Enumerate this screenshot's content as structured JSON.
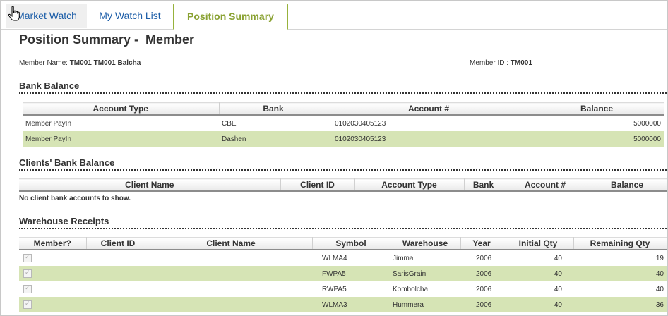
{
  "tabs": {
    "market_watch": "Market Watch",
    "my_watch_list": "My Watch List",
    "position_summary": "Position Summary"
  },
  "page": {
    "title": "Position Summary -  Member",
    "member_name_label": "Member Name:",
    "member_name_value": "TM001 TM001 Balcha",
    "member_id_label": "Member ID :",
    "member_id_value": "TM001"
  },
  "bank_balance": {
    "title": "Bank Balance",
    "headers": [
      "Account Type",
      "Bank",
      "Account #",
      "Balance"
    ],
    "rows": [
      {
        "account_type": "Member PayIn",
        "bank": "CBE",
        "account": "0102030405123",
        "balance": "5000000"
      },
      {
        "account_type": "Member PayIn",
        "bank": "Dashen",
        "account": "0102030405123",
        "balance": "5000000"
      }
    ]
  },
  "clients_bank_balance": {
    "title": "Clients' Bank Balance",
    "headers": [
      "Client Name",
      "Client ID",
      "Account Type",
      "Bank",
      "Account #",
      "Balance"
    ],
    "empty_message": "No client bank accounts to show."
  },
  "warehouse_receipts": {
    "title": "Warehouse Receipts",
    "headers": [
      "Member?",
      "Client ID",
      "Client Name",
      "Symbol",
      "Warehouse",
      "Year",
      "Initial Qty",
      "Remaining Qty"
    ],
    "rows": [
      {
        "member": true,
        "client_id": "",
        "client_name": "",
        "symbol": "WLMA4",
        "warehouse": "Jimma",
        "year": "2006",
        "initial": "40",
        "remaining": "19"
      },
      {
        "member": true,
        "client_id": "",
        "client_name": "",
        "symbol": "FWPA5",
        "warehouse": "SarisGrain",
        "year": "2006",
        "initial": "40",
        "remaining": "40"
      },
      {
        "member": true,
        "client_id": "",
        "client_name": "",
        "symbol": "RWPA5",
        "warehouse": "Kombolcha",
        "year": "2006",
        "initial": "40",
        "remaining": "40"
      },
      {
        "member": true,
        "client_id": "",
        "client_name": "",
        "symbol": "WLMA3",
        "warehouse": "Hummera",
        "year": "2006",
        "initial": "40",
        "remaining": "36"
      }
    ]
  }
}
